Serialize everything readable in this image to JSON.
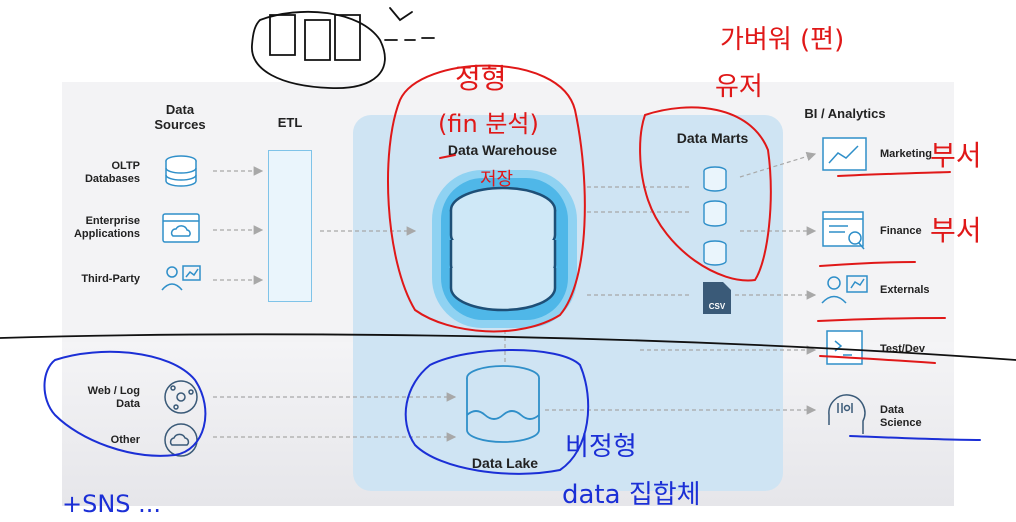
{
  "diagram": {
    "headers": {
      "data_sources": "Data\nSources",
      "etl": "ETL",
      "bi_analytics": "BI / Analytics"
    },
    "sources": [
      {
        "label": "OLTP\nDatabases",
        "icon": "database-stack-icon"
      },
      {
        "label": "Enterprise\nApplications",
        "icon": "browser-cloud-icon"
      },
      {
        "label": "Third-Party",
        "icon": "person-chart-icon"
      },
      {
        "label": "Web / Log\nData",
        "icon": "network-icon"
      },
      {
        "label": "Other",
        "icon": "cloud-sync-icon"
      }
    ],
    "warehouse": {
      "label": "Data Warehouse"
    },
    "data_marts": {
      "label": "Data Marts"
    },
    "data_lake": {
      "label": "Data Lake"
    },
    "csv_badge": "CSV",
    "consumers": [
      {
        "label": "Marketing",
        "icon": "line-chart-icon"
      },
      {
        "label": "Finance",
        "icon": "report-search-icon"
      },
      {
        "label": "Externals",
        "icon": "person-chart-icon"
      },
      {
        "label": "Test/Dev",
        "icon": "terminal-icon"
      },
      {
        "label": "Data\nScience",
        "icon": "head-binary-icon"
      }
    ],
    "colors": {
      "accent_blue": "#2f8fc9",
      "icon_navy": "#3a5a78",
      "platform_bg": "#cfe4f3",
      "arrow_gray": "#a8a8a8",
      "annotation_red": "#e01818",
      "annotation_blue": "#1b2fd6"
    }
  },
  "annotations": [
    {
      "text": "정형",
      "color": "red"
    },
    {
      "text": "(fin 분석)",
      "color": "red"
    },
    {
      "text": "저장",
      "color": "red"
    },
    {
      "text": "가벼워 (편)",
      "color": "red"
    },
    {
      "text": "유저",
      "color": "red"
    },
    {
      "text": "부서",
      "color": "red"
    },
    {
      "text": "부서",
      "color": "red"
    },
    {
      "text": "비정형",
      "color": "blue"
    },
    {
      "text": "data 집합체",
      "color": "blue"
    },
    {
      "text": "+SNS ...",
      "color": "blue"
    }
  ]
}
